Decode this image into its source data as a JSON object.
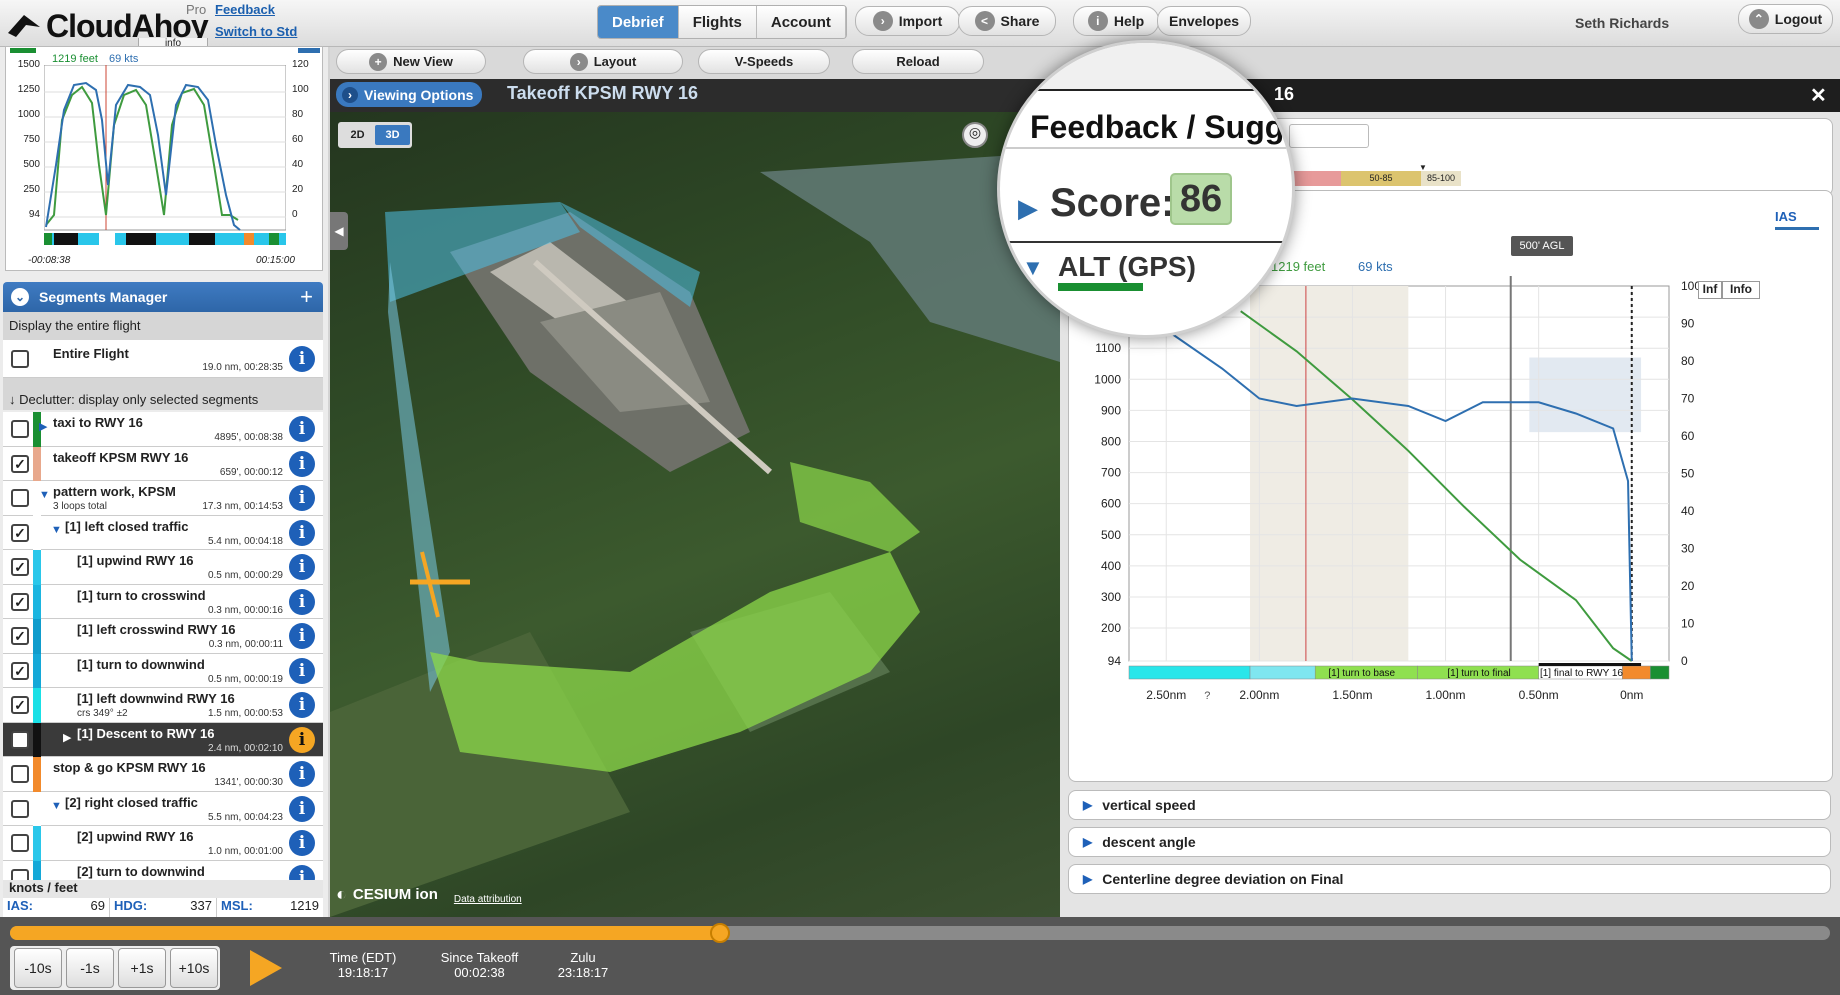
{
  "app": {
    "brand": "CloudAhoy",
    "tier": "Pro",
    "feedback_link": "Feedback",
    "switch_link": "Switch to Std",
    "user": "Seth Richards"
  },
  "nav": {
    "tabs": [
      "Debrief",
      "Flights",
      "Account"
    ],
    "active_tab": "Debrief"
  },
  "toolbar": {
    "import": "Import",
    "share": "Share",
    "help": "Help",
    "envelopes": "Envelopes",
    "logout": "Logout"
  },
  "secondbar": {
    "new_view": "New View",
    "layout": "Layout",
    "vspeeds": "V-Speeds",
    "reload": "Reload"
  },
  "viewbar": {
    "viewing_options": "Viewing Options",
    "title": "Takeoff KPSM RWY 16",
    "mode_2d": "2D",
    "mode_3d": "3D"
  },
  "minichart": {
    "tab": "info",
    "readout_alt": "1219 feet",
    "readout_ias": "69 kts",
    "left_ticks": [
      "1500",
      "1250",
      "1000",
      "750",
      "500",
      "250",
      "94"
    ],
    "right_ticks": [
      "120",
      "100",
      "80",
      "60",
      "40",
      "20",
      "0"
    ],
    "time_start": "-00:08:38",
    "time_end": "00:15:00"
  },
  "segments": {
    "title": "Segments Manager",
    "display_entire": "Display the entire flight",
    "declutter": "Declutter: display only selected segments",
    "units_label": "knots / feet",
    "entire": {
      "label": "Entire Flight",
      "meta": "19.0 nm, 00:28:35"
    },
    "items": [
      {
        "label": "taxi to RWY 16",
        "meta": "4895', 00:08:38",
        "checked": false,
        "color": "#1a8f32",
        "sub": ""
      },
      {
        "label": "takeoff KPSM RWY 16",
        "meta": "659', 00:00:12",
        "checked": true,
        "color": "#e8a88c",
        "sub": ""
      },
      {
        "label": "pattern work, KPSM",
        "meta": "17.3 nm, 00:14:53",
        "checked": false,
        "color": "#ffffff",
        "sub": "3 loops total"
      },
      {
        "label": "[1] left closed traffic",
        "meta": "5.4 nm, 00:04:18",
        "checked": true,
        "color": "#ffffff",
        "sub": ""
      },
      {
        "label": "[1] upwind RWY 16",
        "meta": "0.5 nm, 00:00:29",
        "checked": true,
        "color": "#2ac7ea",
        "sub": ""
      },
      {
        "label": "[1] turn to crosswind",
        "meta": "0.3 nm, 00:00:16",
        "checked": true,
        "color": "#1bb5e0",
        "sub": ""
      },
      {
        "label": "[1] left crosswind RWY 16",
        "meta": "0.3 nm, 00:00:11",
        "checked": true,
        "color": "#0f9ccc",
        "sub": ""
      },
      {
        "label": "[1] turn to downwind",
        "meta": "0.5 nm, 00:00:19",
        "checked": true,
        "color": "#14a8d8",
        "sub": ""
      },
      {
        "label": "[1] left downwind RWY 16",
        "meta": "1.5 nm, 00:00:53",
        "checked": true,
        "color": "#19e0e6",
        "sub": "crs 349° ±2"
      },
      {
        "label": "[1] Descent to RWY 16",
        "meta": "2.4 nm, 00:02:10",
        "checked": true,
        "color": "#111111",
        "sub": ""
      },
      {
        "label": "stop & go KPSM RWY 16",
        "meta": "1341', 00:00:30",
        "checked": false,
        "color": "#f28a2c",
        "sub": ""
      },
      {
        "label": "[2] right closed traffic",
        "meta": "5.5 nm, 00:04:23",
        "checked": false,
        "color": "#ffffff",
        "sub": ""
      },
      {
        "label": "[2] upwind RWY 16",
        "meta": "1.0 nm, 00:01:00",
        "checked": false,
        "color": "#2ac7ea",
        "sub": ""
      },
      {
        "label": "[2] turn to downwind",
        "meta": "",
        "checked": false,
        "color": "#14a8d8",
        "sub": ""
      }
    ],
    "readouts": [
      {
        "label": "IAS:",
        "value": "69"
      },
      {
        "label": "HDG:",
        "value": "337"
      },
      {
        "label": "MSL:",
        "value": "1219"
      }
    ]
  },
  "map": {
    "attribution_logo": "CESIUM ion",
    "attribution_link": "Data attribution"
  },
  "rightpanel": {
    "title": "Feedback / Suggestions ... 16",
    "title_suffix": "16",
    "score_label": "Score:",
    "score_value": "86",
    "score_bands": [
      "50-85",
      "85-100"
    ],
    "section_alt": "ALT (GPS)",
    "ias_tab": "IAS",
    "agl_marker": "500' AGL",
    "readout_alt": "1219 feet",
    "readout_ias": "69 kts",
    "info_button": "Info",
    "info_button_partial": "Inf",
    "chart_data": {
      "type": "line",
      "xlabel": "",
      "x_ticks": [
        "2.50nm",
        "2.00nm",
        "1.50nm",
        "1.00nm",
        "0.50nm",
        "0nm"
      ],
      "y_left_ticks": [
        "1200",
        "1100",
        "1000",
        "900",
        "800",
        "700",
        "600",
        "500",
        "400",
        "300",
        "200",
        "94"
      ],
      "y_right_ticks": [
        "100",
        "90",
        "80",
        "70",
        "60",
        "50",
        "40",
        "30",
        "20",
        "10",
        "0"
      ],
      "ylim_left": [
        94,
        1300
      ],
      "ylim_right": [
        0,
        100
      ],
      "series": [
        {
          "color": "#3f9b3f",
          "axis": "left",
          "x": [
            2.1,
            1.8,
            1.5,
            1.2,
            0.9,
            0.6,
            0.3,
            0.1,
            0.0
          ],
          "values": [
            1219,
            1090,
            935,
            770,
            590,
            420,
            290,
            135,
            94
          ]
        },
        {
          "color": "#2e6fb0",
          "axis": "right",
          "x": [
            2.55,
            2.2,
            2.0,
            1.8,
            1.5,
            1.2,
            1.0,
            0.8,
            0.5,
            0.3,
            0.1,
            0.02,
            0.0
          ],
          "values": [
            90,
            78,
            70,
            68,
            70,
            68,
            64,
            69,
            69,
            66,
            62,
            48,
            0
          ]
        }
      ],
      "segment_labels": [
        "[1] turn to base",
        "[1] turn to final",
        "[1] final to RWY 16"
      ]
    }
  },
  "collapsibles": [
    "vertical speed",
    "descent angle",
    "Centerline degree deviation on Final"
  ],
  "playback": {
    "steps": [
      "-10s",
      "-1s",
      "+1s",
      "+10s"
    ],
    "time_edt_label": "Time (EDT)",
    "time_edt": "19:18:17",
    "since_takeoff_label": "Since Takeoff",
    "since_takeoff": "00:02:38",
    "zulu_label": "Zulu",
    "zulu": "23:18:17",
    "progress": 0.39
  },
  "colors": {
    "accent": "#2e66a8",
    "progress": "#f5a623",
    "altitude_line": "#3f9b3f",
    "ias_line": "#2e6fb0"
  }
}
